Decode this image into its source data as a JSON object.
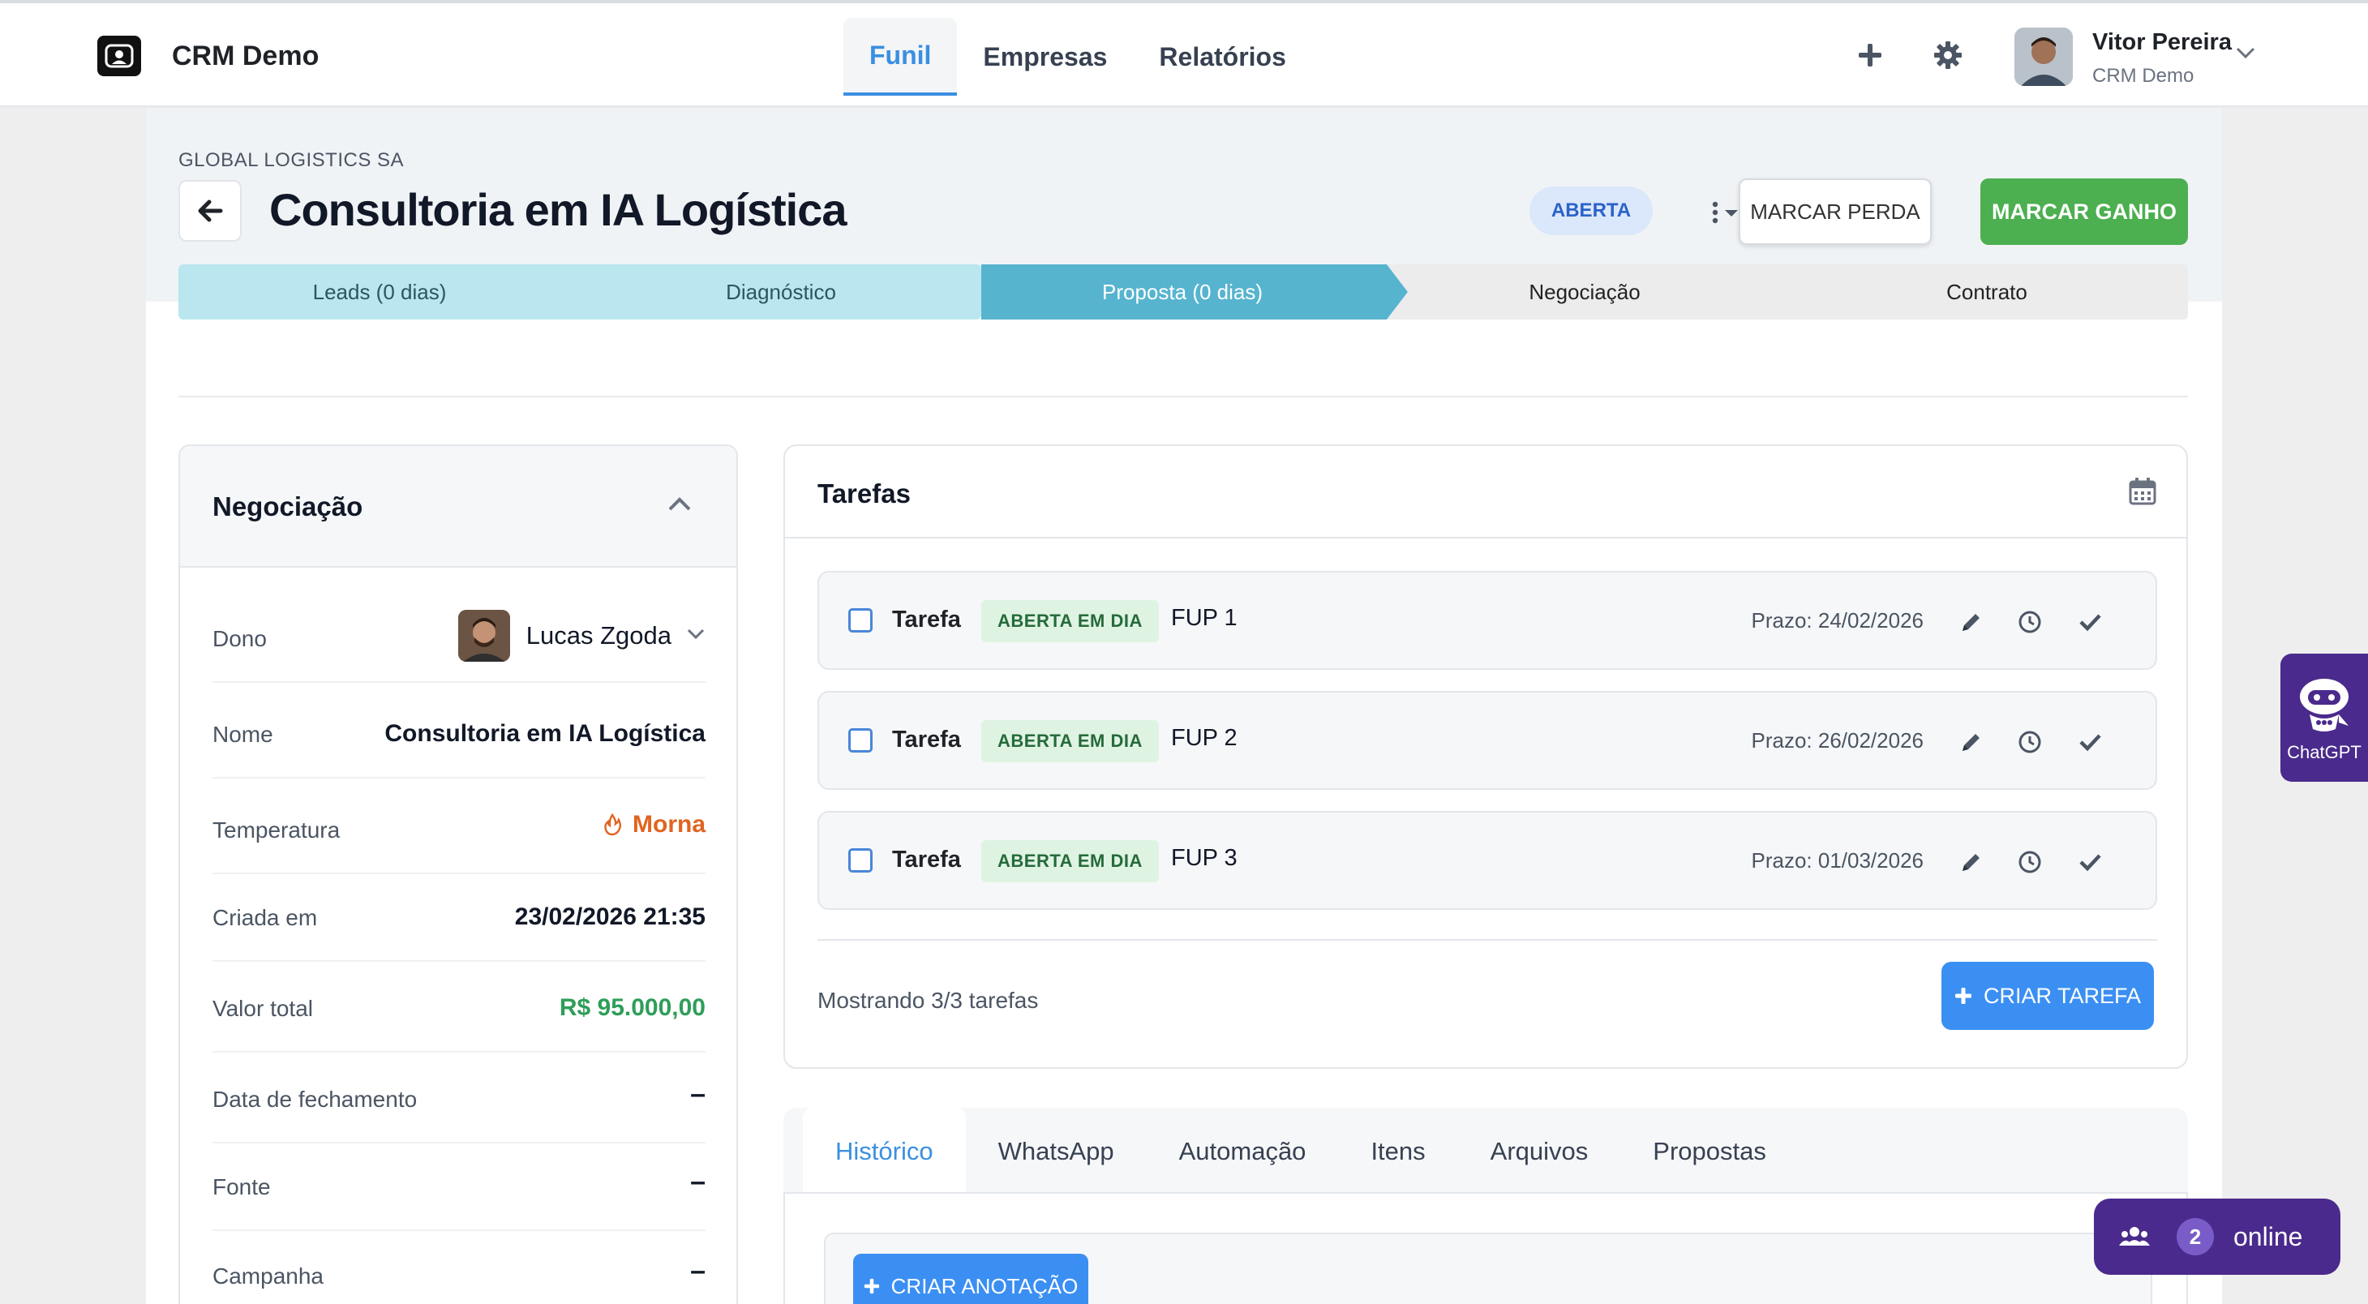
{
  "app": {
    "name": "CRM Demo"
  },
  "nav": {
    "tabs": [
      {
        "label": "Funil"
      },
      {
        "label": "Empresas"
      },
      {
        "label": "Relatórios"
      }
    ],
    "active": "Funil"
  },
  "user": {
    "name": "Vitor Pereira",
    "org": "CRM Demo"
  },
  "deal": {
    "company": "GLOBAL LOGISTICS SA",
    "title": "Consultoria em IA Logística",
    "status": "ABERTA",
    "lose_label": "MARCAR PERDA",
    "win_label": "MARCAR GANHO"
  },
  "pipeline": {
    "stages": [
      {
        "label": "Leads (0 dias)",
        "state": "done"
      },
      {
        "label": "Diagnóstico",
        "state": "done"
      },
      {
        "label": "Proposta (0 dias)",
        "state": "current"
      },
      {
        "label": "Negociação",
        "state": "todo"
      },
      {
        "label": "Contrato",
        "state": "todo"
      }
    ]
  },
  "negotiation": {
    "title": "Negociação",
    "fields": {
      "owner": {
        "label": "Dono",
        "value": "Lucas Zgoda"
      },
      "name": {
        "label": "Nome",
        "value": "Consultoria em IA Logística"
      },
      "temperature": {
        "label": "Temperatura",
        "value": "Morna"
      },
      "created": {
        "label": "Criada em",
        "value": "23/02/2026 21:35"
      },
      "total": {
        "label": "Valor total",
        "value": "R$ 95.000,00"
      },
      "close_date": {
        "label": "Data de fechamento",
        "value": "–"
      },
      "source": {
        "label": "Fonte",
        "value": "–"
      },
      "campaign": {
        "label": "Campanha",
        "value": "–"
      }
    }
  },
  "tasks": {
    "title": "Tarefas",
    "items": [
      {
        "type": "Tarefa",
        "badge": "ABERTA EM DIA",
        "name": "FUP 1",
        "due": "Prazo: 24/02/2026"
      },
      {
        "type": "Tarefa",
        "badge": "ABERTA EM DIA",
        "name": "FUP 2",
        "due": "Prazo: 26/02/2026"
      },
      {
        "type": "Tarefa",
        "badge": "ABERTA EM DIA",
        "name": "FUP 3",
        "due": "Prazo: 01/03/2026"
      }
    ],
    "count_text": "Mostrando 3/3 tarefas",
    "create_label": "CRIAR TAREFA"
  },
  "detail_tabs": {
    "items": [
      {
        "label": "Histórico"
      },
      {
        "label": "WhatsApp"
      },
      {
        "label": "Automação"
      },
      {
        "label": "Itens"
      },
      {
        "label": "Arquivos"
      },
      {
        "label": "Propostas"
      }
    ],
    "active": "Histórico",
    "create_note_label": "CRIAR ANOTAÇÃO"
  },
  "widgets": {
    "chatgpt_label": "ChatGPT",
    "online_count": "2",
    "online_label": "online"
  },
  "colors": {
    "accent": "#3b8fe0",
    "win": "#4caf50",
    "money": "#2e9e58",
    "warm": "#e06420",
    "widget": "#4a2a8c"
  },
  "icons": {
    "back": "arrow-left-icon",
    "add": "plus-icon",
    "settings": "gear-icon",
    "calendar": "calendar-icon",
    "edit": "pencil-icon",
    "snooze": "clock-icon",
    "complete": "check-icon",
    "temperature": "flame-icon"
  }
}
